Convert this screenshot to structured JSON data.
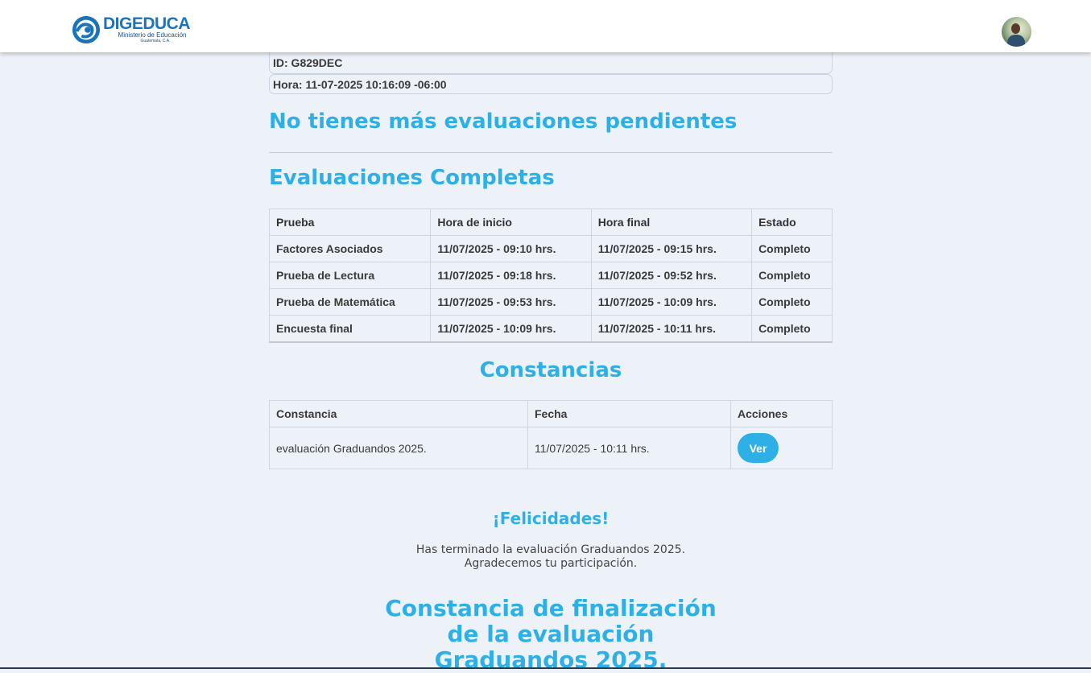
{
  "header": {
    "logo": {
      "title": "DIGEDUCA",
      "subtitle": "Ministerio de Educación",
      "location": "Guatemala, C.A."
    }
  },
  "info": {
    "id_text": "ID: G829DEC",
    "hora_text": "Hora: 11-07-2025 10:16:09 -06:00"
  },
  "pending_heading": "No tienes más evaluaciones pendientes",
  "complete_heading": "Evaluaciones Completas",
  "evaluations": {
    "headers": [
      "Prueba",
      "Hora de inicio",
      "Hora final",
      "Estado"
    ],
    "rows": [
      [
        "Factores Asociados",
        "11/07/2025 - 09:10 hrs.",
        "11/07/2025 - 09:15 hrs.",
        "Completo"
      ],
      [
        "Prueba de Lectura",
        "11/07/2025 - 09:18 hrs.",
        "11/07/2025 - 09:52 hrs.",
        "Completo"
      ],
      [
        "Prueba de Matemática",
        "11/07/2025 - 09:53 hrs.",
        "11/07/2025 - 10:09 hrs.",
        "Completo"
      ],
      [
        "Encuesta final",
        "11/07/2025 - 10:09 hrs.",
        "11/07/2025 - 10:11 hrs.",
        "Completo"
      ]
    ]
  },
  "constancias": {
    "heading": "Constancias",
    "headers": [
      "Constancia",
      "Fecha",
      "Acciones"
    ],
    "rows": [
      {
        "name": "evaluación Graduandos 2025.",
        "date": "11/07/2025 - 10:11 hrs.",
        "action": "Ver"
      }
    ]
  },
  "congrats": {
    "title": "¡Felicidades!",
    "message": "Has terminado la evaluación Graduandos 2025. Agradecemos tu participación."
  },
  "final_heading": "Constancia de finalización de la evaluación Graduandos 2025.",
  "colors": {
    "accent": "#2eb0e6",
    "background": "#edf2f9",
    "logo_blue": "#1b74bb"
  }
}
